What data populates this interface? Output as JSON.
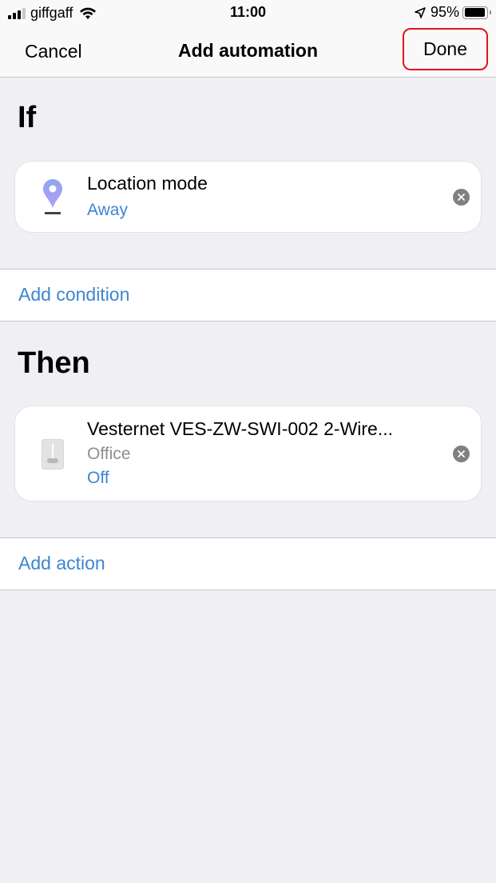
{
  "status_bar": {
    "carrier": "giffgaff",
    "time": "11:00",
    "battery_percent_label": "95%",
    "battery_level": 0.95,
    "icons": [
      "signal-icon",
      "wifi-icon",
      "location-arrow-icon",
      "battery-icon"
    ]
  },
  "nav": {
    "cancel_label": "Cancel",
    "title": "Add automation",
    "done_label": "Done",
    "done_highlight_color": "#e0141e"
  },
  "if_section": {
    "title": "If",
    "conditions": [
      {
        "icon": "location-pin-icon",
        "title": "Location mode",
        "value": "Away"
      }
    ],
    "add_label": "Add condition"
  },
  "then_section": {
    "title": "Then",
    "actions": [
      {
        "icon": "switch-icon",
        "title": "Vesternet VES-ZW-SWI-002 2-Wire...",
        "room": "Office",
        "value": "Off"
      }
    ],
    "add_label": "Add action"
  },
  "colors": {
    "accent": "#3e85d1",
    "background": "#efeff4",
    "pin": "#9aa3f0"
  }
}
